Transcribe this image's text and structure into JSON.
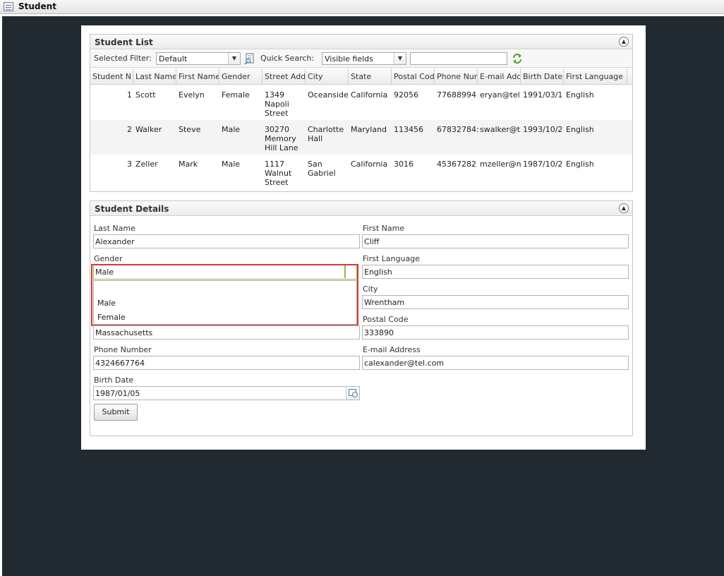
{
  "window": {
    "title": "Student",
    "icon": "window-list-icon"
  },
  "student_list": {
    "title": "Student List",
    "filter_label": "Selected Filter:",
    "filter_value": "Default",
    "quick_search_label": "Quick Search:",
    "quick_search_scope": "Visible fields",
    "quick_search_value": "",
    "columns": [
      "Student N",
      "Last Name",
      "First Name",
      "Gender",
      "Street Add",
      "City",
      "State",
      "Postal Cod",
      "Phone Num",
      "E-mail Add",
      "Birth Date",
      "First Language"
    ],
    "rows": [
      {
        "num": "1",
        "last": "Scott",
        "first": "Evelyn",
        "gender": "Female",
        "street": "1349 Napoli Street",
        "city": "Oceanside",
        "state": "California",
        "postal": "92056",
        "phone": "77688994",
        "email": "eryan@tel",
        "birth": "1991/03/1",
        "language": "English"
      },
      {
        "num": "2",
        "last": "Walker",
        "first": "Steve",
        "gender": "Male",
        "street": "30270 Memory Hill Lane",
        "city": "Charlotte Hall",
        "state": "Maryland",
        "postal": "113456",
        "phone": "67832784:",
        "email": "swalker@t",
        "birth": "1993/10/2",
        "language": "English"
      },
      {
        "num": "3",
        "last": "Zeller",
        "first": "Mark",
        "gender": "Male",
        "street": "1117 Walnut Street",
        "city": "San Gabriel",
        "state": "California",
        "postal": "3016",
        "phone": "45367282",
        "email": "mzeller@n",
        "birth": "1987/10/2",
        "language": "English"
      }
    ]
  },
  "student_details": {
    "title": "Student Details",
    "last_name_label": "Last Name",
    "last_name": "Alexander",
    "first_name_label": "First Name",
    "first_name": "Cliff",
    "gender_label": "Gender",
    "gender": "Male",
    "gender_options": [
      "",
      "Male",
      "Female"
    ],
    "first_language_label": "First Language",
    "first_language": "English",
    "city_label": "City",
    "city": "Wrentham",
    "state": "Massachusetts",
    "postal_code_label": "Postal Code",
    "postal_code": "333890",
    "phone_label": "Phone Number",
    "phone": "4324667764",
    "email_label": "E-mail Address",
    "email": "calexander@tel.com",
    "birth_date_label": "Birth Date",
    "birth_date": "1987/01/05",
    "submit_label": "Submit"
  },
  "colors": {
    "background": "#202a30",
    "focus": "#8fba3e",
    "highlight": "#d83a36"
  }
}
